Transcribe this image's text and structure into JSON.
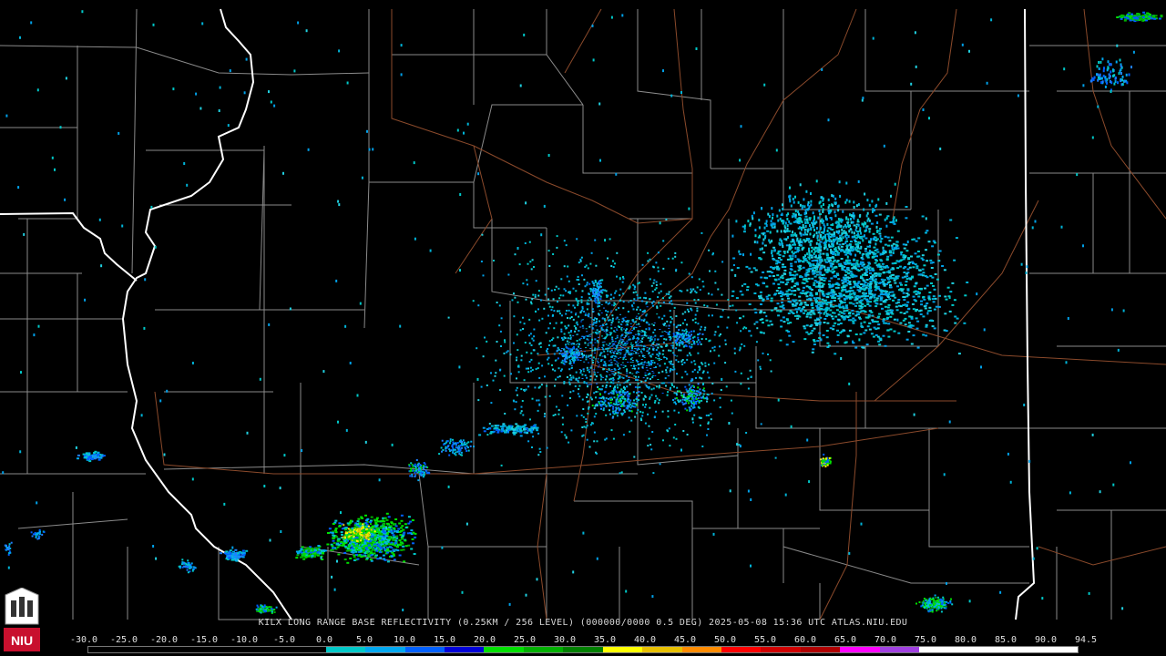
{
  "product_caption": "KILX LONG RANGE BASE REFLECTIVITY (0.25KM / 256 LEVEL) (000000/0000 0.5 DEG) 2025-05-08 15:36 UTC  ATLAS.NIU.EDU",
  "logo_text": "NIU",
  "scale": {
    "labels": [
      "-30.0",
      "-25.0",
      "-20.0",
      "-15.0",
      "-10.0",
      "-5.0",
      "0.0",
      "5.0",
      "10.0",
      "15.0",
      "20.0",
      "25.0",
      "30.0",
      "35.0",
      "40.0",
      "45.0",
      "50.0",
      "55.0",
      "60.0",
      "65.0",
      "70.0",
      "75.0",
      "80.0",
      "85.0",
      "90.0",
      "94.5"
    ],
    "colors": [
      "#000000",
      "#000000",
      "#000000",
      "#000000",
      "#000000",
      "#000000",
      "#00c8c8",
      "#00a8f0",
      "#0060ff",
      "#0000d8",
      "#00e000",
      "#00b000",
      "#008000",
      "#ffff00",
      "#e8c000",
      "#ff8c00",
      "#ff0000",
      "#d00000",
      "#b00000",
      "#ff00ff",
      "#a040e0",
      "#ffffff",
      "#ffffff",
      "#ffffff",
      "#ffffff"
    ]
  },
  "colors": {
    "background": "#000000",
    "county_lines": "#8a8a8a",
    "state_lines": "#ffffff",
    "highways": "#8b4a2b"
  }
}
